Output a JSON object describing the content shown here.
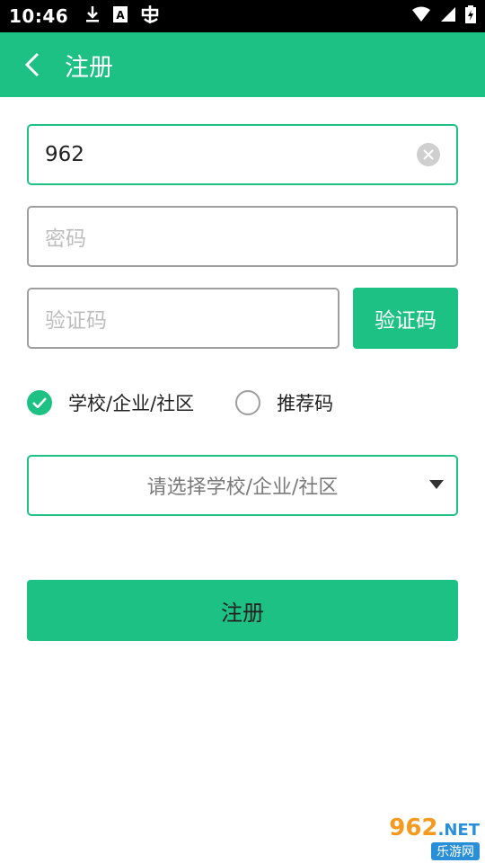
{
  "status_bar": {
    "time": "10:46",
    "icons": [
      "download-icon",
      "text-a-icon",
      "notification-icon",
      "wifi-icon",
      "signal-icon",
      "battery-icon"
    ]
  },
  "app_bar": {
    "title": "注册"
  },
  "form": {
    "phone": {
      "value": "962"
    },
    "password": {
      "placeholder": "密码"
    },
    "captcha": {
      "placeholder": "验证码",
      "button_label": "验证码"
    },
    "options": [
      {
        "label": "学校/企业/社区",
        "checked": true
      },
      {
        "label": "推荐码",
        "checked": false
      }
    ],
    "select": {
      "placeholder": "请选择学校/企业/社区"
    },
    "submit_label": "注册"
  },
  "watermark": {
    "top": "962",
    "suffix": ".NET",
    "bottom": "乐游网"
  },
  "colors": {
    "accent": "#1ec184",
    "status_bar": "#000000"
  }
}
